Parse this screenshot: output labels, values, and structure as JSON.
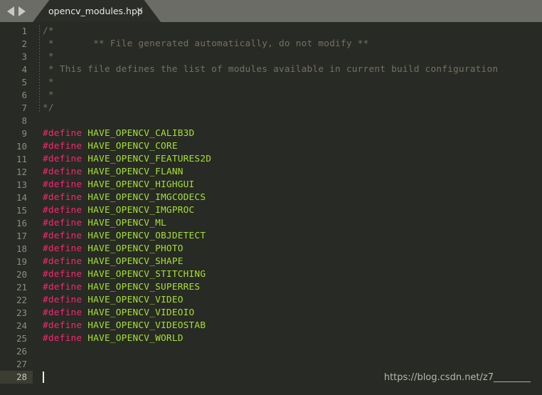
{
  "window": {
    "title": "opencv_modules.hpp",
    "background_color": "#282a25",
    "tabbar_color": "#6b6c66"
  },
  "tabbar": {
    "nav_back_icon": "arrow-left-icon",
    "nav_forward_icon": "arrow-right-icon",
    "tabs": [
      {
        "label": "opencv_modules.hpp",
        "active": true,
        "close_label": "✕"
      }
    ]
  },
  "editor": {
    "language": "cpp",
    "active_line": 28,
    "cursor": {
      "line": 28,
      "column": 1
    },
    "total_lines": 28,
    "colors": {
      "comment": "#75715e",
      "preprocessor": "#f92672",
      "macro_name": "#a6e22e",
      "line_number": "#8b8d7f",
      "line_number_active": "#c3c5b8",
      "active_line_gutter_bg": "#3b3d33",
      "caret": "#f0f0ea"
    },
    "lines": [
      {
        "n": "1",
        "tokens": [
          {
            "t": "comment",
            "s": "/*"
          }
        ]
      },
      {
        "n": "2",
        "tokens": [
          {
            "t": "comment",
            "s": " *       ** File generated automatically, do not modify **"
          }
        ]
      },
      {
        "n": "3",
        "tokens": [
          {
            "t": "comment",
            "s": " *"
          }
        ]
      },
      {
        "n": "4",
        "tokens": [
          {
            "t": "comment",
            "s": " * This file defines the list of modules available in current build configuration"
          }
        ]
      },
      {
        "n": "5",
        "tokens": [
          {
            "t": "comment",
            "s": " *"
          }
        ]
      },
      {
        "n": "6",
        "tokens": [
          {
            "t": "comment",
            "s": " *"
          }
        ]
      },
      {
        "n": "7",
        "tokens": [
          {
            "t": "comment",
            "s": "*/"
          }
        ]
      },
      {
        "n": "8",
        "tokens": []
      },
      {
        "n": "9",
        "tokens": [
          {
            "t": "pre",
            "s": "#define"
          },
          {
            "t": "macro",
            "s": " HAVE_OPENCV_CALIB3D"
          }
        ]
      },
      {
        "n": "10",
        "tokens": [
          {
            "t": "pre",
            "s": "#define"
          },
          {
            "t": "macro",
            "s": " HAVE_OPENCV_CORE"
          }
        ]
      },
      {
        "n": "11",
        "tokens": [
          {
            "t": "pre",
            "s": "#define"
          },
          {
            "t": "macro",
            "s": " HAVE_OPENCV_FEATURES2D"
          }
        ]
      },
      {
        "n": "12",
        "tokens": [
          {
            "t": "pre",
            "s": "#define"
          },
          {
            "t": "macro",
            "s": " HAVE_OPENCV_FLANN"
          }
        ]
      },
      {
        "n": "13",
        "tokens": [
          {
            "t": "pre",
            "s": "#define"
          },
          {
            "t": "macro",
            "s": " HAVE_OPENCV_HIGHGUI"
          }
        ]
      },
      {
        "n": "14",
        "tokens": [
          {
            "t": "pre",
            "s": "#define"
          },
          {
            "t": "macro",
            "s": " HAVE_OPENCV_IMGCODECS"
          }
        ]
      },
      {
        "n": "15",
        "tokens": [
          {
            "t": "pre",
            "s": "#define"
          },
          {
            "t": "macro",
            "s": " HAVE_OPENCV_IMGPROC"
          }
        ]
      },
      {
        "n": "16",
        "tokens": [
          {
            "t": "pre",
            "s": "#define"
          },
          {
            "t": "macro",
            "s": " HAVE_OPENCV_ML"
          }
        ]
      },
      {
        "n": "17",
        "tokens": [
          {
            "t": "pre",
            "s": "#define"
          },
          {
            "t": "macro",
            "s": " HAVE_OPENCV_OBJDETECT"
          }
        ]
      },
      {
        "n": "18",
        "tokens": [
          {
            "t": "pre",
            "s": "#define"
          },
          {
            "t": "macro",
            "s": " HAVE_OPENCV_PHOTO"
          }
        ]
      },
      {
        "n": "19",
        "tokens": [
          {
            "t": "pre",
            "s": "#define"
          },
          {
            "t": "macro",
            "s": " HAVE_OPENCV_SHAPE"
          }
        ]
      },
      {
        "n": "20",
        "tokens": [
          {
            "t": "pre",
            "s": "#define"
          },
          {
            "t": "macro",
            "s": " HAVE_OPENCV_STITCHING"
          }
        ]
      },
      {
        "n": "21",
        "tokens": [
          {
            "t": "pre",
            "s": "#define"
          },
          {
            "t": "macro",
            "s": " HAVE_OPENCV_SUPERRES"
          }
        ]
      },
      {
        "n": "22",
        "tokens": [
          {
            "t": "pre",
            "s": "#define"
          },
          {
            "t": "macro",
            "s": " HAVE_OPENCV_VIDEO"
          }
        ]
      },
      {
        "n": "23",
        "tokens": [
          {
            "t": "pre",
            "s": "#define"
          },
          {
            "t": "macro",
            "s": " HAVE_OPENCV_VIDEOIO"
          }
        ]
      },
      {
        "n": "24",
        "tokens": [
          {
            "t": "pre",
            "s": "#define"
          },
          {
            "t": "macro",
            "s": " HAVE_OPENCV_VIDEOSTAB"
          }
        ]
      },
      {
        "n": "25",
        "tokens": [
          {
            "t": "pre",
            "s": "#define"
          },
          {
            "t": "macro",
            "s": " HAVE_OPENCV_WORLD"
          }
        ]
      },
      {
        "n": "26",
        "tokens": []
      },
      {
        "n": "27",
        "tokens": []
      },
      {
        "n": "28",
        "tokens": []
      }
    ]
  },
  "watermark": {
    "text": "https://blog.csdn.net/z7________"
  }
}
